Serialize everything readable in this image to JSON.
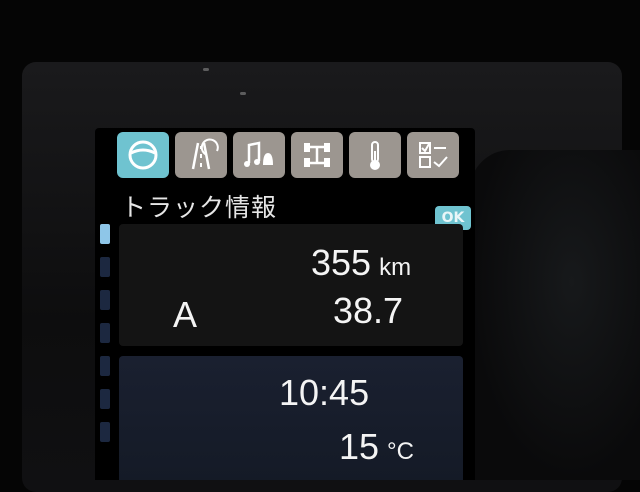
{
  "screen": {
    "tabs": [
      {
        "icon": "steering-wheel-icon",
        "active": true
      },
      {
        "icon": "lane-assist-icon",
        "active": false
      },
      {
        "icon": "music-bell-icon",
        "active": false
      },
      {
        "icon": "drivetrain-icon",
        "active": false
      },
      {
        "icon": "temperature-icon",
        "active": false
      },
      {
        "icon": "checklist-icon",
        "active": false
      }
    ],
    "title": "トラック情報",
    "ok_label": "OK",
    "trip": {
      "distance": "355",
      "distance_unit": "km",
      "label": "A",
      "value": "38.7"
    },
    "clock": {
      "time": "10:45",
      "temperature": "15",
      "temperature_unit": "°C"
    }
  },
  "colors": {
    "accent": "#6fc3d0",
    "tab_inactive": "#9c9690",
    "text": "#f4f4f4"
  }
}
